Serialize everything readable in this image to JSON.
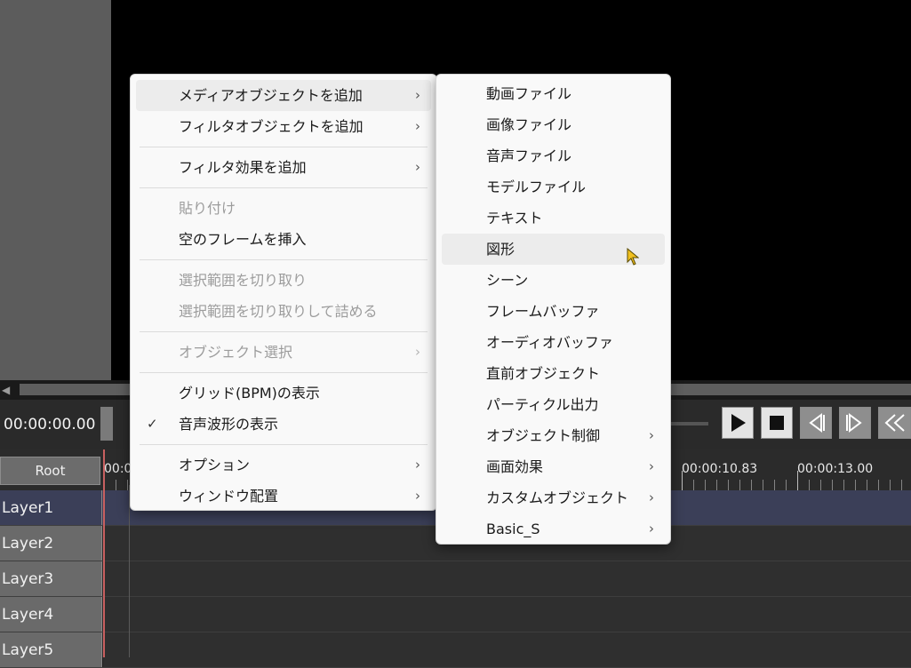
{
  "transport": {
    "timecode": "00:00:00.00",
    "buttons": [
      {
        "name": "play-button",
        "icon": "play-icon"
      },
      {
        "name": "stop-button",
        "icon": "stop-icon"
      },
      {
        "name": "prev-frame-button",
        "icon": "step-back-icon"
      },
      {
        "name": "next-frame-button",
        "icon": "step-forward-icon"
      },
      {
        "name": "rewind-button",
        "icon": "rewind-icon"
      }
    ]
  },
  "timeline": {
    "root_label": "Root",
    "ruler_labels": [
      "00:0",
      "00:00:10.83",
      "00:00:13.00"
    ],
    "layers": [
      "Layer1",
      "Layer2",
      "Layer3",
      "Layer4",
      "Layer5"
    ],
    "active_layer": "Layer1"
  },
  "context_menu": {
    "items": [
      {
        "label": "メディアオブジェクトを追加",
        "submenu": true,
        "state": "hover"
      },
      {
        "label": "フィルタオブジェクトを追加",
        "submenu": true
      },
      {
        "label": "フィルタ効果を追加",
        "submenu": true
      },
      {
        "label": "貼り付け",
        "disabled": true
      },
      {
        "label": "空のフレームを挿入"
      },
      {
        "label": "選択範囲を切り取り",
        "disabled": true
      },
      {
        "label": "選択範囲を切り取りして詰める",
        "disabled": true
      },
      {
        "label": "オブジェクト選択",
        "submenu": true,
        "disabled": true
      },
      {
        "label": "グリッド(BPM)の表示"
      },
      {
        "label": "音声波形の表示",
        "checked": true
      },
      {
        "label": "オプション",
        "submenu": true
      },
      {
        "label": "ウィンドウ配置",
        "submenu": true
      }
    ]
  },
  "media_submenu": {
    "items": [
      {
        "label": "動画ファイル"
      },
      {
        "label": "画像ファイル"
      },
      {
        "label": "音声ファイル"
      },
      {
        "label": "モデルファイル"
      },
      {
        "label": "テキスト"
      },
      {
        "label": "図形",
        "state": "hover"
      },
      {
        "label": "シーン"
      },
      {
        "label": "フレームバッファ"
      },
      {
        "label": "オーディオバッファ"
      },
      {
        "label": "直前オブジェクト"
      },
      {
        "label": "パーティクル出力"
      },
      {
        "label": "オブジェクト制御",
        "submenu": true
      },
      {
        "label": "画面効果",
        "submenu": true
      },
      {
        "label": "カスタムオブジェクト",
        "submenu": true
      },
      {
        "label": "Basic_S",
        "submenu": true
      }
    ]
  },
  "glyphs": {
    "chevron": "›",
    "check": "✓",
    "scroll_left": "◀"
  },
  "colors": {
    "menu_bg": "#f9f9f9",
    "hover_bg": "#ececec",
    "active_layer": "#3b3f58",
    "playhead": "#c86060",
    "cursor": "#f0c020"
  }
}
